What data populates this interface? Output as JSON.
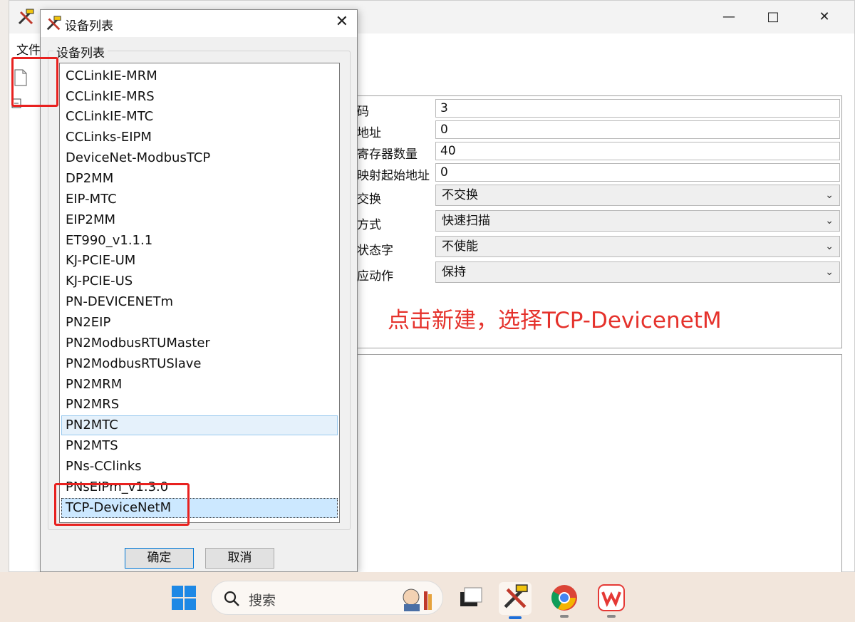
{
  "main_window": {
    "menu_file": "文件",
    "properties": [
      {
        "label": "码",
        "value": "3",
        "kind": "input"
      },
      {
        "label": "地址",
        "value": "0",
        "kind": "input"
      },
      {
        "label": "寄存器数量",
        "value": "40",
        "kind": "input"
      },
      {
        "label": "映射起始地址",
        "value": "0",
        "kind": "input"
      },
      {
        "label": "交换",
        "value": "不交换",
        "kind": "select"
      },
      {
        "label": "方式",
        "value": "快速扫描",
        "kind": "select"
      },
      {
        "label": "状态字",
        "value": "不使能",
        "kind": "select"
      },
      {
        "label": "应动作",
        "value": "保持",
        "kind": "select"
      }
    ],
    "annotation": "点击新建，选择TCP-DevicenetM"
  },
  "dialog": {
    "title": "设备列表",
    "group_label": "设备列表",
    "items": [
      "CCLinkIE-MRM",
      "CCLinkIE-MRS",
      "CCLinkIE-MTC",
      "CCLinks-EIPM",
      "DeviceNet-ModbusTCP",
      "DP2MM",
      "EIP-MTC",
      "EIP2MM",
      "ET990_v1.1.1",
      "KJ-PCIE-UM",
      "KJ-PCIE-US",
      "PN-DEVICENETm",
      "PN2EIP",
      "PN2ModbusRTUMaster",
      "PN2ModbusRTUSlave",
      "PN2MRM",
      "PN2MRS",
      "PN2MTC",
      "PN2MTS",
      "PNs-CClinks",
      "PNsEIPm_v1.3.0",
      "TCP-DeviceNetM"
    ],
    "hover_item": "PN2MTC",
    "selected_item": "TCP-DeviceNetM",
    "ok_label": "确定",
    "cancel_label": "取消"
  },
  "taskbar": {
    "search_placeholder": "搜索"
  },
  "colors": {
    "annotation_red": "#e5322c",
    "selection_blue": "#cce8ff",
    "accent_blue": "#0078d7"
  }
}
